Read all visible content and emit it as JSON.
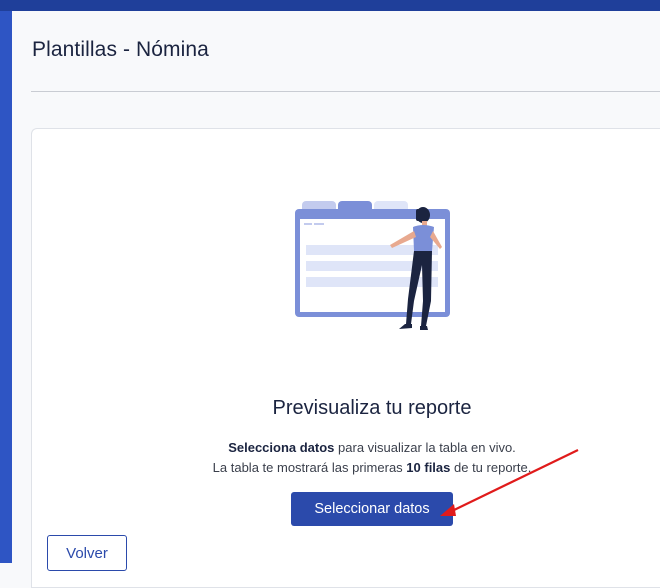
{
  "page": {
    "title": "Plantillas - Nómina"
  },
  "preview_card": {
    "heading": "Previsualiza tu reporte",
    "line1_bold": "Selecciona datos",
    "line1_rest": " para visualizar la tabla en vivo.",
    "line2_start": "La tabla te mostrará las primeras ",
    "line2_bold": "10 filas",
    "line2_end": " de tu reporte.",
    "primary_button": "Seleccionar datos"
  },
  "footer": {
    "back_button": "Volver"
  },
  "colors": {
    "accent": "#2b4aab",
    "top_bar": "#1f3f9a",
    "annotation_arrow": "#e01b1b"
  },
  "icons": {
    "illustration": "woman-browser-illustration",
    "annotation": "red-arrow-annotation"
  }
}
